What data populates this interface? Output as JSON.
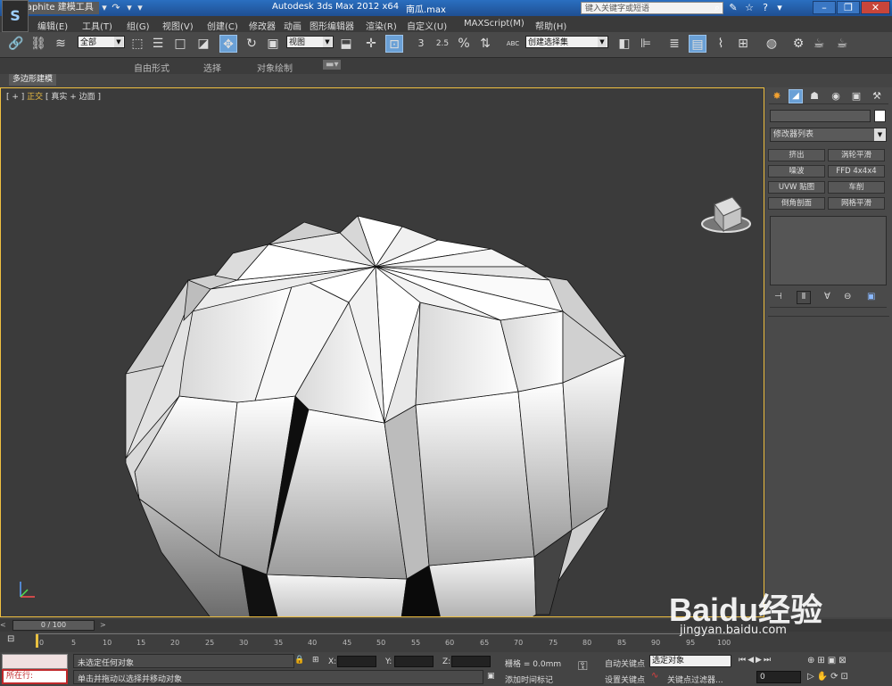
{
  "titlebar": {
    "logo": "S",
    "app_title": "Autodesk 3ds Max  2012 x64",
    "file_title": "南瓜.max",
    "search_placeholder": "键入关键字或短语"
  },
  "menu": [
    "编辑(E)",
    "工具(T)",
    "组(G)",
    "视图(V)",
    "创建(C)",
    "修改器",
    "动画",
    "图形编辑器",
    "渲染(R)",
    "自定义(U)",
    "MAXScript(M)",
    "帮助(H)"
  ],
  "toolbar": {
    "selection_filter": "全部",
    "ref_coord": "视图",
    "named_selection": "创建选择集",
    "abc_label": "ABC",
    "snap_labels": [
      "3",
      "2.5",
      "%"
    ]
  },
  "ribbon": {
    "tabs": [
      "Graphite 建模工具",
      "自由形式",
      "选择",
      "对象绘制"
    ],
    "subtab": "多边形建模"
  },
  "viewport": {
    "label_prefix": "[ + ] ",
    "label_view": "正交",
    "label_rest": " [ 真实 + 边面 ]"
  },
  "command_panel": {
    "modifier_list": "修改器列表",
    "buttons": [
      "挤出",
      "涡轮平滑",
      "噪波",
      "FFD 4x4x4",
      "UVW 贴图",
      "车削",
      "倒角剖面",
      "网格平滑"
    ]
  },
  "timeline": {
    "frame_display": "0 / 100",
    "ticks": [
      "0",
      "5",
      "10",
      "15",
      "20",
      "25",
      "30",
      "35",
      "40",
      "45",
      "50",
      "55",
      "60",
      "65",
      "70",
      "75",
      "80",
      "85",
      "90",
      "95",
      "100"
    ]
  },
  "status": {
    "maxscript_label": "所在行:",
    "selection_status": "未选定任何对象",
    "prompt": "单击并拖动以选择并移动对象",
    "x_label": "X:",
    "y_label": "Y:",
    "z_label": "Z:",
    "grid": "栅格 = 0.0mm",
    "add_time_tag": "添加时间标记",
    "auto_key": "自动关键点",
    "set_key": "设置关键点",
    "selected_objects": "选定对象",
    "key_filters": "关键点过滤器...",
    "frame_value": "0"
  },
  "watermark": {
    "brand": "Baidu经验",
    "url": "jingyan.baidu.com"
  },
  "colors": {
    "title_bar": "#2a6fc0",
    "viewport_border": "#f0c040",
    "active_tool": "#6aa0d6",
    "status_red_box": "#c0282a"
  }
}
